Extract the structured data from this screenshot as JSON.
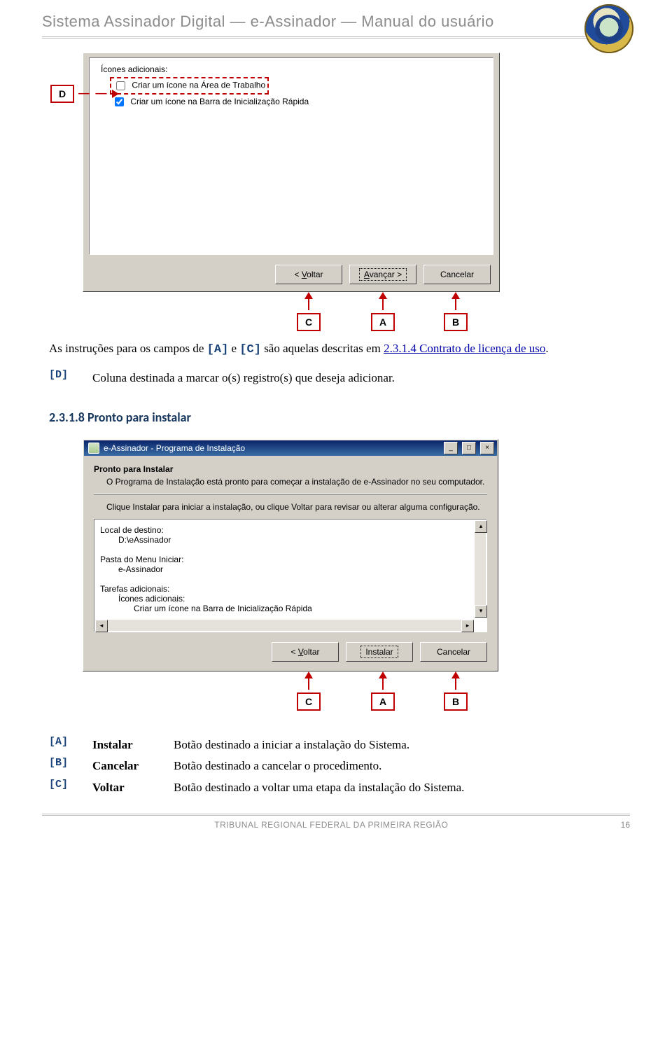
{
  "header": {
    "title": "Sistema Assinador Digital — e-Assinador — Manual do usuário"
  },
  "figure1": {
    "tag_d": "D",
    "icons_label": "Ícones adicionais:",
    "opt1": "Criar um ícone na Área de Trabalho",
    "opt2": "Criar um ícone na Barra de Inicialização Rápida",
    "btn_back": "< Voltar",
    "btn_next_u": "A",
    "btn_next_rest": "vançar >",
    "btn_cancel": "Cancelar",
    "tag_c": "C",
    "tag_a": "A",
    "tag_b": "B"
  },
  "text": {
    "intro_pre": "As instruções para os campos de ",
    "intro_a": "[A]",
    "intro_mid": " e ",
    "intro_c": "[C]",
    "intro_after": " são aquelas descritas em ",
    "intro_link": "2.3.1.4 Contrato de licença de uso",
    "intro_end": ".",
    "d_mark": "[D]",
    "d_desc": "Coluna destinada a marcar o(s) registro(s) que deseja adicionar."
  },
  "heading": "2.3.1.8 Pronto para instalar",
  "figure2": {
    "title": "e-Assinador - Programa de Instalação",
    "h": "Pronto para Instalar",
    "sub": "O Programa de Instalação está pronto para começar a instalação de e-Assinador no seu computador.",
    "hint": "Clique Instalar para iniciar a instalação, ou clique Voltar para revisar ou alterar alguma configuração.",
    "l1": "Local de destino:",
    "l1v": "D:\\eAssinador",
    "l2": "Pasta do Menu Iniciar:",
    "l2v": "e-Assinador",
    "l3": "Tarefas adicionais:",
    "l3a": "Ícones adicionais:",
    "l3b": "Criar um ícone na Barra de Inicialização Rápida",
    "btn_back": "< Voltar",
    "btn_install": "Instalar",
    "btn_cancel": "Cancelar",
    "tag_c": "C",
    "tag_a": "A",
    "tag_b": "B"
  },
  "legend": {
    "a_mark": "[A]",
    "a_term": "Instalar",
    "a_desc": "Botão destinado a iniciar a instalação do Sistema.",
    "b_mark": "[B]",
    "b_term": "Cancelar",
    "b_desc": "Botão destinado a cancelar o procedimento.",
    "c_mark": "[C]",
    "c_term": "Voltar",
    "c_desc": "Botão destinado a voltar uma etapa da instalação do Sistema."
  },
  "footer": {
    "org": "TRIBUNAL REGIONAL FEDERAL DA PRIMEIRA REGIÃO",
    "page": "16"
  },
  "titlebar_min": "_",
  "titlebar_max": "□",
  "titlebar_close": "×",
  "sb_up": "▴",
  "sb_down": "▾",
  "sb_left": "◂",
  "sb_right": "▸"
}
